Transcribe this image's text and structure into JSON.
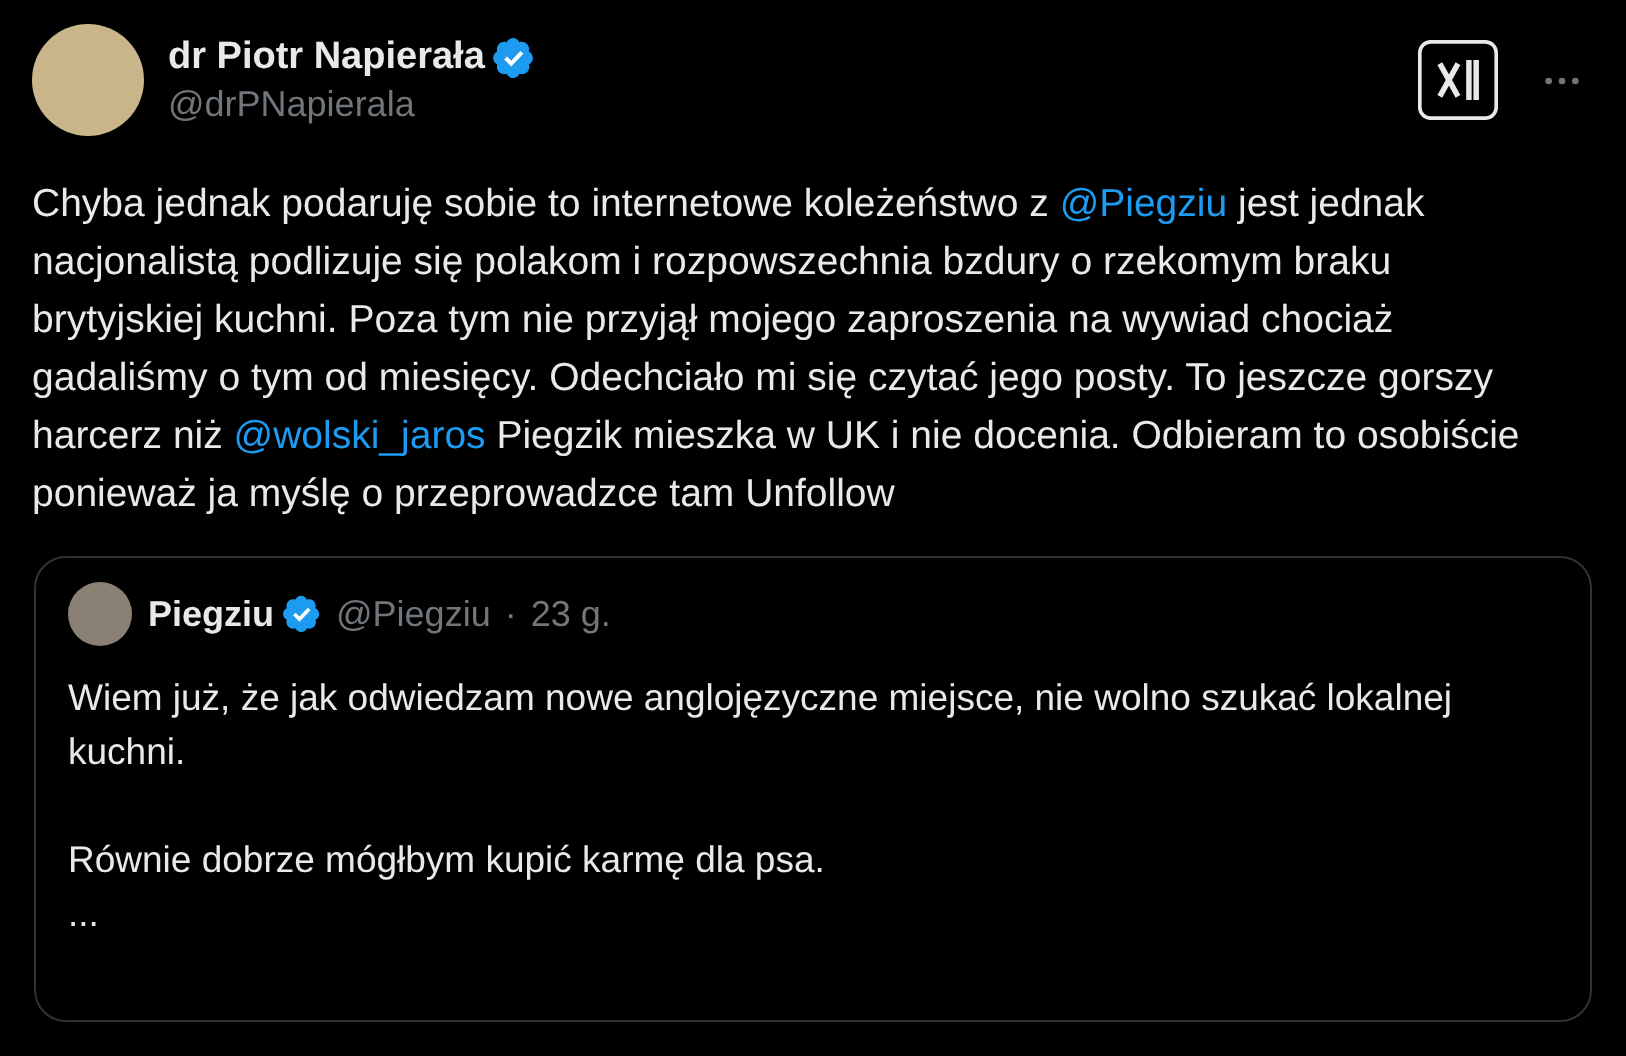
{
  "author": {
    "name": "dr Piotr Napierała",
    "handle": "@drPNapierala",
    "verified": true
  },
  "body": [
    {
      "kind": "text",
      "text": "Chyba jednak podaruję sobie to internetowe koleżeństwo z "
    },
    {
      "kind": "mention",
      "text": "@Piegziu"
    },
    {
      "kind": "text",
      "text": " jest jednak nacjonalistą podlizuje się polakom i rozpowszechnia bzdury o rzekomym braku brytyjskiej kuchni. Poza tym nie przyjął mojego zaproszenia na wywiad chociaż gadaliśmy o tym od miesięcy. Odechciało mi się czytać jego posty. To jeszcze gorszy harcerz niż "
    },
    {
      "kind": "mention",
      "text": "@wolski_jaros"
    },
    {
      "kind": "text",
      "text": "   Piegzik mieszka w UK i nie docenia. Odbieram to osobiście ponieważ ja myślę o przeprowadzce tam Unfollow"
    }
  ],
  "quote": {
    "name": "Piegziu",
    "verified": true,
    "handle": "@Piegziu",
    "separator": "·",
    "time": "23 g.",
    "paragraphs": [
      "Wiem już, że jak odwiedzam nowe anglojęzyczne miejsce, nie wolno szukać lokalnej kuchni.",
      "Równie dobrze mógłbym kupić karmę dla psa.",
      "..."
    ]
  }
}
